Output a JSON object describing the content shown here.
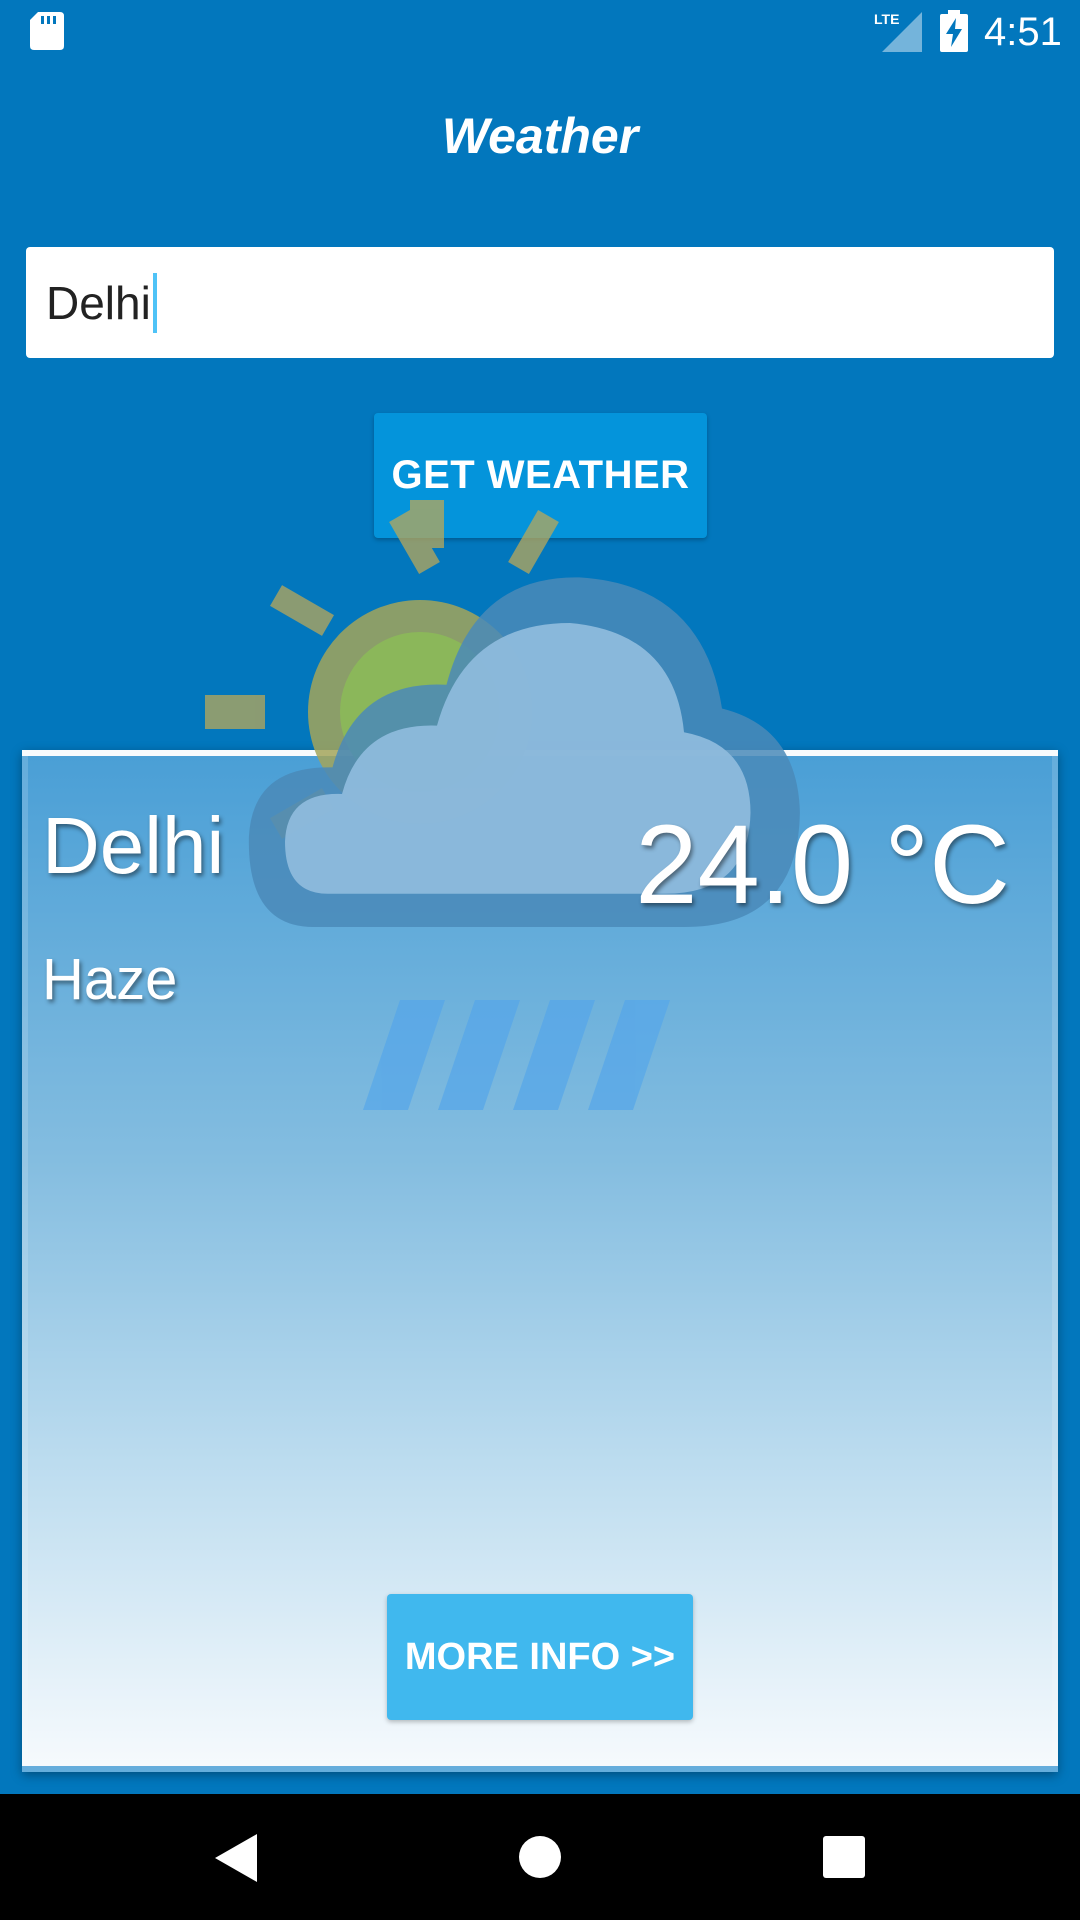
{
  "status_bar": {
    "time": "4:51",
    "network_label": "LTE",
    "icons": [
      "sd-card-icon",
      "lte-signal-icon",
      "battery-charging-icon"
    ]
  },
  "app": {
    "title": "Weather"
  },
  "search": {
    "value": "Delhi",
    "button_label": "GET WEATHER"
  },
  "result": {
    "city": "Delhi",
    "temperature": "24.0 °C",
    "condition": "Haze",
    "condition_icon": "partly-cloudy-rain-icon",
    "more_info_label": "MORE INFO >>"
  },
  "nav_bar": {
    "icons": [
      "back-icon",
      "home-icon",
      "recents-icon"
    ]
  },
  "colors": {
    "background": "#0277bd",
    "button": "#0494db",
    "more_info_button": "#40b8ee",
    "caret": "#4fc3f7"
  }
}
